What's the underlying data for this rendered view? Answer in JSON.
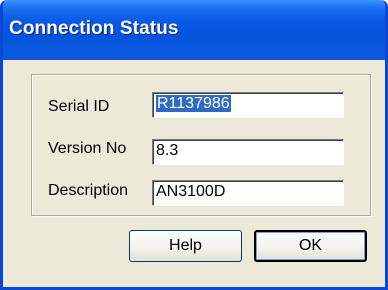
{
  "dialog": {
    "title": "Connection Status"
  },
  "fields": {
    "serial_id": {
      "label": "Serial ID",
      "value": "R1137986"
    },
    "version_no": {
      "label": "Version No",
      "value": "8.3"
    },
    "description": {
      "label": "Description",
      "value": "AN3100D"
    }
  },
  "buttons": {
    "help": "Help",
    "ok": "OK"
  },
  "colors": {
    "titlebar": "#0a5ae6",
    "dialog_bg": "#ece9d8",
    "selection": "#316ac5"
  }
}
